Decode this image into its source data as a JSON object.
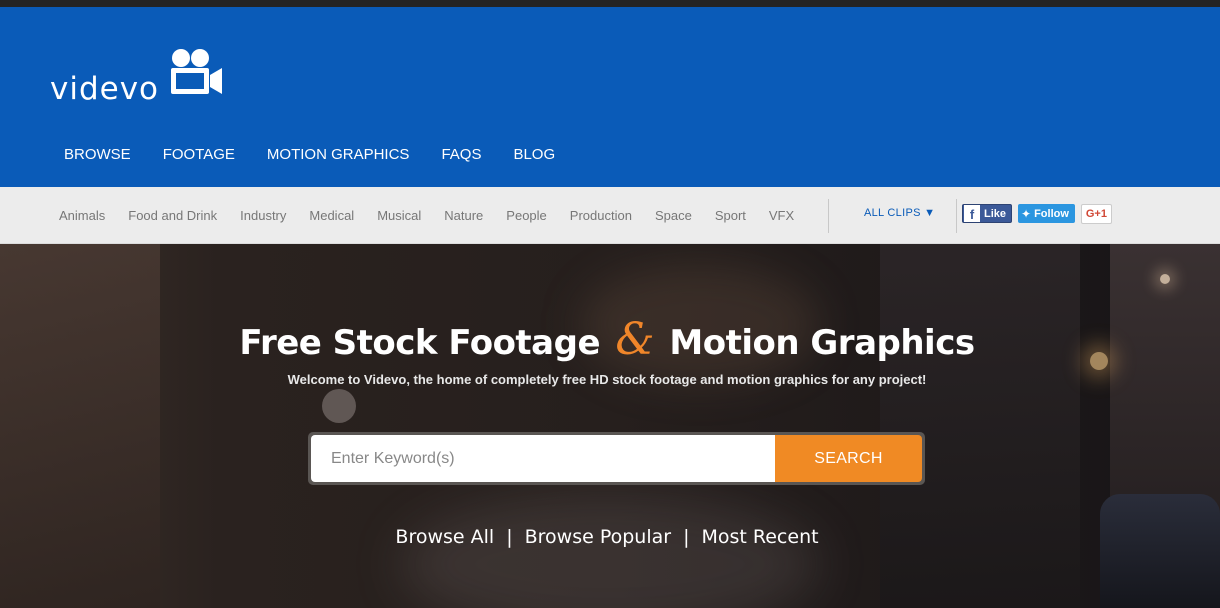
{
  "brand": {
    "logo_text": "videvo",
    "accent": "#0a5bb8",
    "cta_color": "#f08a24"
  },
  "nav": {
    "items": [
      {
        "label": "BROWSE"
      },
      {
        "label": "FOOTAGE"
      },
      {
        "label": "MOTION GRAPHICS"
      },
      {
        "label": "FAQS"
      },
      {
        "label": "BLOG"
      }
    ]
  },
  "categories": {
    "items": [
      {
        "label": "Animals"
      },
      {
        "label": "Food and Drink"
      },
      {
        "label": "Industry"
      },
      {
        "label": "Medical"
      },
      {
        "label": "Musical"
      },
      {
        "label": "Nature"
      },
      {
        "label": "People"
      },
      {
        "label": "Production"
      },
      {
        "label": "Space"
      },
      {
        "label": "Sport"
      },
      {
        "label": "VFX"
      }
    ],
    "all_clips_label": "ALL CLIPS ▼"
  },
  "social": {
    "like_label": "Like",
    "follow_label": "Follow",
    "gplus_label": "G+1"
  },
  "hero": {
    "title_part1": "Free Stock Footage",
    "title_amp": "&",
    "title_part2": "Motion Graphics",
    "subtitle": "Welcome to Videvo, the home of completely free HD stock footage and motion graphics for any project!"
  },
  "search": {
    "placeholder": "Enter Keyword(s)",
    "button_label": "SEARCH"
  },
  "browse_links": {
    "browse_all": "Browse All",
    "separator": "|",
    "browse_popular": "Browse Popular",
    "most_recent": "Most Recent"
  }
}
